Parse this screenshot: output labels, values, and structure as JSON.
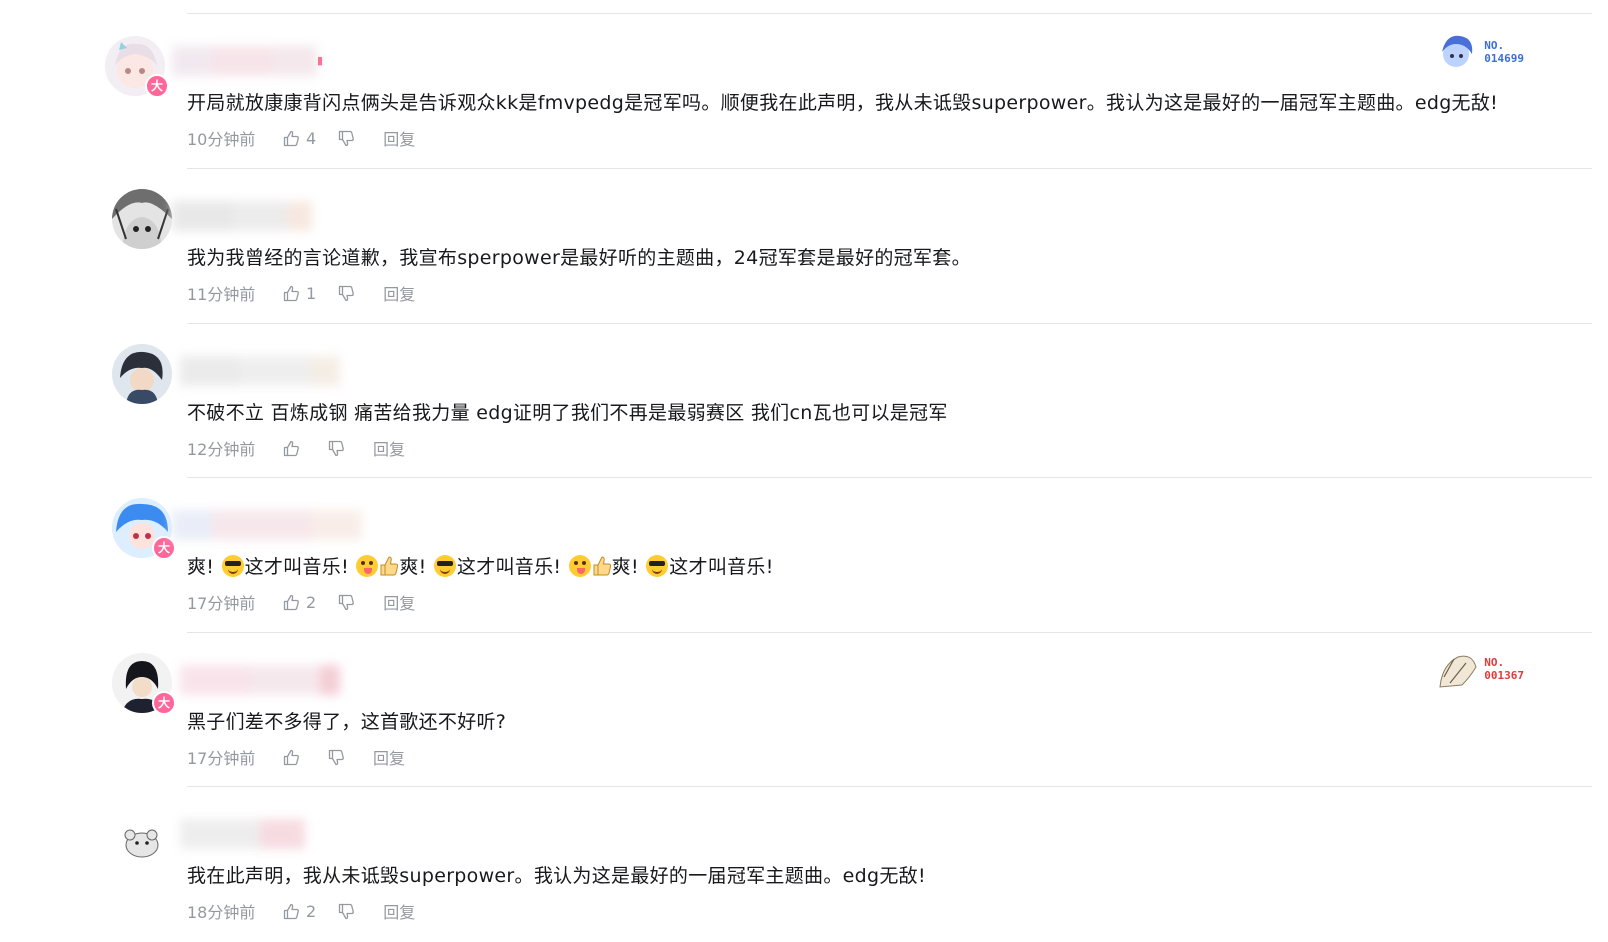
{
  "comments": [
    {
      "content": "开局就放康康背闪点俩头是告诉观众kk是fmvpedg是冠军吗。顺便我在此声明，我从未诋毁superpower。我认为这是最好的一届冠军主题曲。edg无敌!",
      "time": "10分钟前",
      "likes": "4",
      "reply_label": "回复",
      "has_big_badge": true,
      "fan_badge": {
        "no": "NO.\n014699",
        "color": "#3a6fd8"
      }
    },
    {
      "content": "我为我曾经的言论道歉，我宣布sperpower是最好听的主题曲，24冠军套是最好的冠军套。",
      "time": "11分钟前",
      "likes": "1",
      "reply_label": "回复",
      "has_big_badge": false
    },
    {
      "content": "不破不立 百炼成钢 痛苦给我力量 edg证明了我们不再是最弱赛区 我们cn瓦也可以是冠军",
      "time": "12分钟前",
      "likes": "",
      "reply_label": "回复",
      "has_big_badge": false
    },
    {
      "content_parts": [
        "爽!",
        "这才叫音乐!",
        "爽!",
        "这才叫音乐!",
        "爽!",
        "这才叫音乐!"
      ],
      "time": "17分钟前",
      "likes": "2",
      "reply_label": "回复",
      "has_big_badge": true
    },
    {
      "content": "黑子们差不多得了，这首歌还不好听?",
      "time": "17分钟前",
      "likes": "",
      "reply_label": "回复",
      "has_big_badge": true,
      "fan_badge": {
        "no": "NO.\n001367",
        "color": "#e03b3b"
      }
    },
    {
      "content": "我在此声明，我从未诋毁superpower。我认为这是最好的一届冠军主题曲。edg无敌!",
      "time": "18分钟前",
      "likes": "2",
      "reply_label": "回复",
      "has_big_badge": false
    }
  ],
  "icons": {
    "like": "thumbs-up-icon",
    "dislike": "thumbs-down-icon",
    "emoji_cool": "sunglasses-emoji",
    "emoji_tongue": "tongue-out-emoji",
    "emoji_thumb": "thumbs-up-emoji"
  },
  "colors": {
    "text": "#18191c",
    "meta": "#9499a0",
    "divider": "#e3e5e7",
    "big_vip_badge": "#ff6699"
  }
}
